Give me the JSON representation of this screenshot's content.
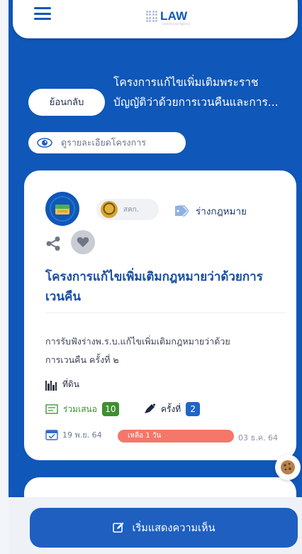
{
  "header": {
    "logo_text": "LAW",
    "logo_subtext": "Central Law Agency"
  },
  "nav": {
    "back_label": "ย้อนกลับ",
    "title_line1": "โครงการแก้ไขเพิ่มเติมพระราช",
    "title_line2": "บัญญัติว่าด้วยการเวนคืนและการ...",
    "detail_label": "ดูรายละเอียดโครงการ"
  },
  "card": {
    "org_label": "สคก.",
    "tag_label": "ร่างกฎหมาย",
    "title_line1": "โครงการแก้ไขเพิ่มเติมกฎหมายว่าด้วยการ",
    "title_line2": "เวนคืน",
    "desc_line1": "การรับฟังร่างพ.ร.บ.แก้ไขเพิ่มเติมกฎหมายว่าด้วย",
    "desc_line2": "การเวนคืน ครั้งที่ ๒",
    "location": "ที่ดิน",
    "participants_label": "ร่วมเสนอ",
    "participants_count": "10",
    "round_label": "ครั้งที่",
    "round_count": "2",
    "start_date": "19 พ.ย. 64",
    "remaining": "เหลือ 1 วัน",
    "remaining_fraction": 0.97,
    "end_date": "03 ธ.ค. 64"
  },
  "footer": {
    "comment_label": "เริ่มแสดงความเห็น"
  },
  "colors": {
    "primary": "#0f57b8",
    "title_blue": "#174fa6",
    "green": "#3f8f2f",
    "remaining_red": "#f4776a"
  },
  "icons": [
    "hamburger-icon",
    "eye-icon",
    "tag-icon",
    "share-icon",
    "heart-icon",
    "location-icon",
    "participants-icon",
    "pen-icon",
    "calendar-icon",
    "cookie-icon",
    "edit-icon"
  ]
}
